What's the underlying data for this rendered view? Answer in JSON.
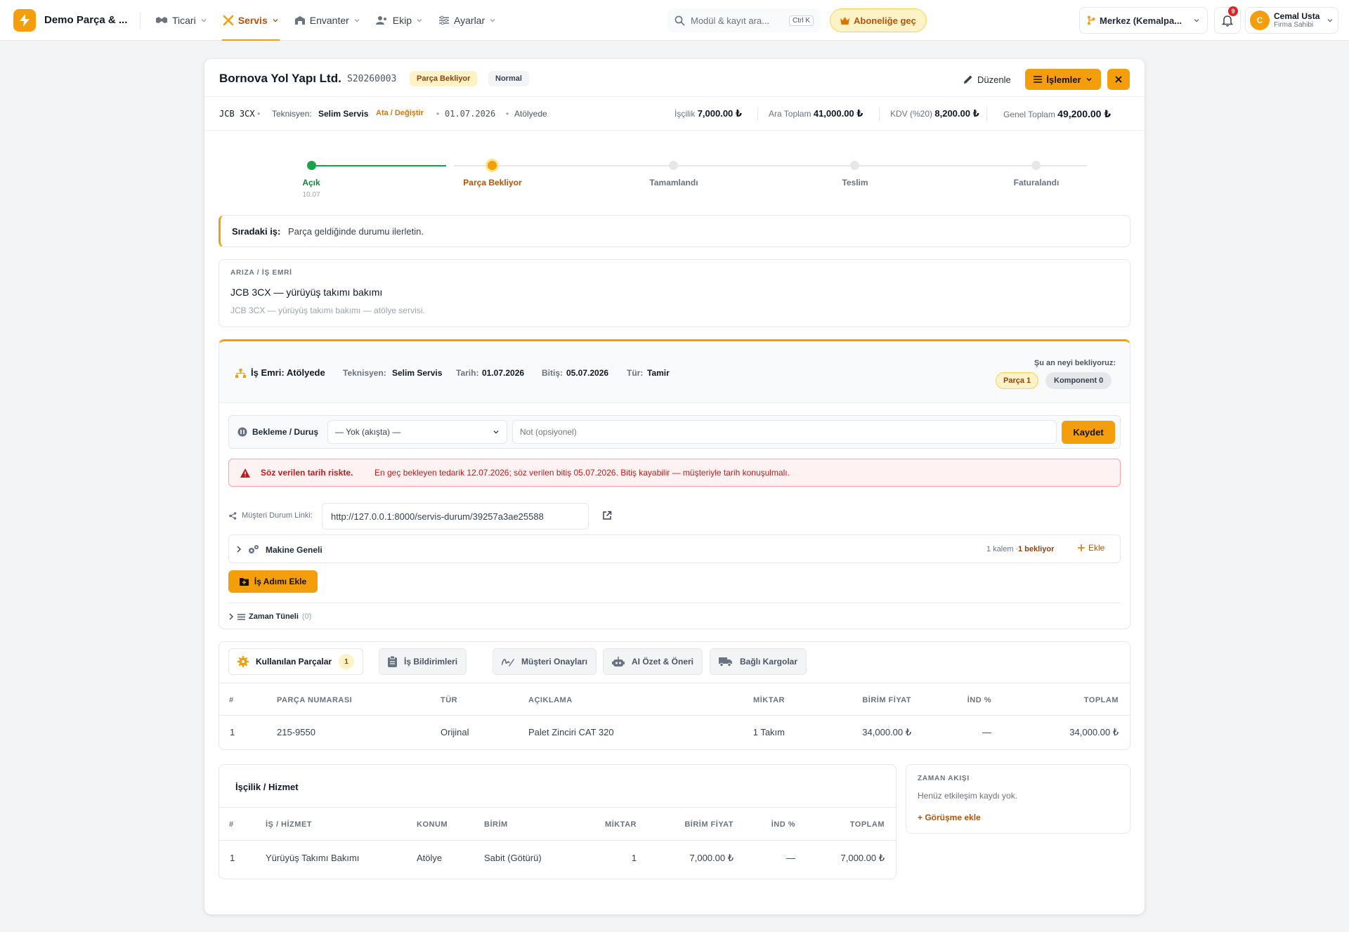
{
  "topbar": {
    "brand": "Demo Parça & ...",
    "nav": [
      {
        "label": "Ticari",
        "icon": "handshake-icon"
      },
      {
        "label": "Servis",
        "icon": "tools-icon",
        "active": true
      },
      {
        "label": "Envanter",
        "icon": "warehouse-icon"
      },
      {
        "label": "Ekip",
        "icon": "users-icon"
      },
      {
        "label": "Ayarlar",
        "icon": "sliders-icon"
      }
    ],
    "search_placeholder": "Modül & kayıt ara...",
    "search_shortcut": "Ctrl K",
    "upgrade_label": "Aboneliğe geç",
    "branch": "Merkez (Kemalpa...",
    "notifications": "9",
    "user_initial": "C",
    "user_name": "Cemal Usta",
    "user_role": "Firma Sahibi",
    "accent": "#f59e0b"
  },
  "header": {
    "customer": "Bornova Yol Yapı Ltd.",
    "code": "S20260003",
    "status": "Parça Bekliyor",
    "priority": "Normal",
    "edit_label": "Düzenle",
    "ops_label": "İşlemler"
  },
  "meta": {
    "machine": "JCB 3CX",
    "tech_label": "Teknisyen:",
    "tech": "Selim Servis",
    "assign": "Ata / Değiştir",
    "date": "01.07.2026",
    "location": "Atölyede",
    "labor_label": "İşçilik",
    "labor": "7,000.00 ₺",
    "subtotal_label": "Ara Toplam",
    "subtotal": "41,000.00 ₺",
    "vat_label": "KDV (%20)",
    "vat": "8,200.00 ₺",
    "total_label": "Genel Toplam",
    "total": "49,200.00 ₺"
  },
  "stepper": {
    "steps": [
      {
        "label": "Açık",
        "date": "10.07",
        "state": "done"
      },
      {
        "label": "Parça Bekliyor",
        "date": "",
        "state": "current"
      },
      {
        "label": "Tamamlandı",
        "date": "",
        "state": "todo"
      },
      {
        "label": "Teslim",
        "date": "",
        "state": "todo"
      },
      {
        "label": "Faturalandı",
        "date": "",
        "state": "todo"
      }
    ]
  },
  "next": {
    "label": "Sıradaki iş:",
    "text": "Parça geldiğinde durumu ilerletin."
  },
  "fault": {
    "heading": "ARIZA / İŞ EMRİ",
    "title": "JCB 3CX — yürüyüş takımı bakımı",
    "desc": "JCB 3CX — yürüyüş takımı bakımı — atölye servisi."
  },
  "workorder": {
    "title": "İş Emri: Atölyede",
    "tech_label": "Teknisyen:",
    "tech": "Selim Servis",
    "date_label": "Tarih:",
    "date": "01.07.2026",
    "end_label": "Bitiş:",
    "end": "05.07.2026",
    "type_label": "Tür:",
    "type": "Tamir",
    "waiting_label": "Şu an neyi bekliyoruz:",
    "wait_part": "Parça 1",
    "wait_component": "Komponent 0",
    "hold_label": "Bekleme / Duruş",
    "hold_value": "— Yok (akışta) —",
    "note_placeholder": "Not (opsiyonel)",
    "save_label": "Kaydet",
    "alert_title": "Söz verilen tarih riskte.",
    "alert_text": "En geç bekleyen tedarik 12.07.2026; söz verilen bitiş 05.07.2026. Bitiş kayabilir — müşteriyle tarih konuşulmalı.",
    "link_label": "Müşteri Durum Linki:",
    "link_value": "http://127.0.0.1:8000/servis-durum/39257a3ae25588",
    "group_label": "Makine Geneli",
    "group_count": "1 kalem · ",
    "group_waiting": "1 bekliyor",
    "add_label": "Ekle",
    "add_step_label": "İş Adımı Ekle",
    "timeline_label": "Zaman Tüneli",
    "timeline_count": "(0)"
  },
  "tabs": [
    {
      "label": "Kullanılan Parçalar",
      "count": "1",
      "icon": "gear-icon"
    },
    {
      "label": "İş Bildirimleri",
      "icon": "clipboard-icon"
    },
    {
      "label": "Müşteri Onayları",
      "icon": "signature-icon"
    },
    {
      "label": "AI Özet & Öneri",
      "icon": "robot-icon"
    },
    {
      "label": "Bağlı Kargolar",
      "icon": "truck-icon"
    }
  ],
  "parts": {
    "headers": [
      "#",
      "PARÇA NUMARASI",
      "TÜR",
      "AÇIKLAMA",
      "MİKTAR",
      "BİRİM FİYAT",
      "İND %",
      "TOPLAM"
    ],
    "rows": [
      [
        "1",
        "215-9550",
        "Orijinal",
        "Palet Zinciri CAT 320",
        "1 Takım",
        "34,000.00 ₺",
        "—",
        "34,000.00 ₺"
      ]
    ]
  },
  "labor": {
    "title": "İşçilik / Hizmet",
    "headers": [
      "#",
      "İŞ / HİZMET",
      "KONUM",
      "BİRİM",
      "MİKTAR",
      "BİRİM FİYAT",
      "İND %",
      "TOPLAM"
    ],
    "rows": [
      [
        "1",
        "Yürüyüş Takımı Bakımı",
        "Atölye",
        "Sabit (Götürü)",
        "1",
        "7,000.00 ₺",
        "—",
        "7,000.00 ₺"
      ]
    ]
  },
  "timeflow": {
    "heading": "ZAMAN AKIŞI",
    "empty": "Henüz etkileşim kaydı yok.",
    "add": "+ Görüşme ekle"
  }
}
